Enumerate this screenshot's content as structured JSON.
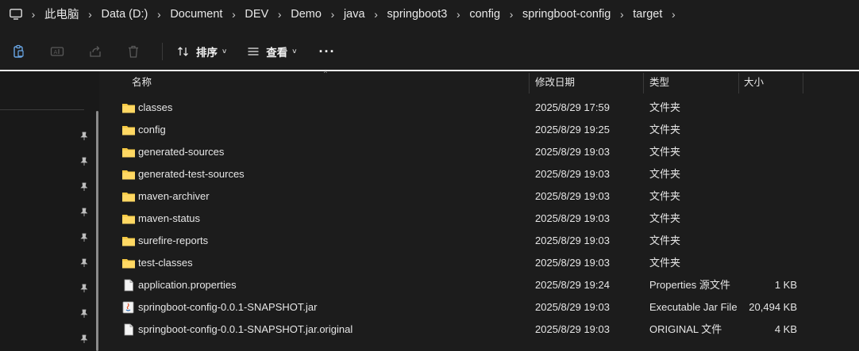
{
  "breadcrumb": {
    "items": [
      "此电脑",
      "Data (D:)",
      "Document",
      "DEV",
      "Demo",
      "java",
      "springboot3",
      "config",
      "springboot-config",
      "target"
    ]
  },
  "toolbar": {
    "sort_label": "排序",
    "view_label": "查看",
    "more_label": "···"
  },
  "columns": {
    "name": "名称",
    "date": "修改日期",
    "type": "类型",
    "size": "大小"
  },
  "files": [
    {
      "name": "classes",
      "date": "2025/8/29 17:59",
      "type": "文件夹",
      "size": "",
      "icon": "folder-icon"
    },
    {
      "name": "config",
      "date": "2025/8/29 19:25",
      "type": "文件夹",
      "size": "",
      "icon": "folder-icon"
    },
    {
      "name": "generated-sources",
      "date": "2025/8/29 19:03",
      "type": "文件夹",
      "size": "",
      "icon": "folder-icon"
    },
    {
      "name": "generated-test-sources",
      "date": "2025/8/29 19:03",
      "type": "文件夹",
      "size": "",
      "icon": "folder-icon"
    },
    {
      "name": "maven-archiver",
      "date": "2025/8/29 19:03",
      "type": "文件夹",
      "size": "",
      "icon": "folder-icon"
    },
    {
      "name": "maven-status",
      "date": "2025/8/29 19:03",
      "type": "文件夹",
      "size": "",
      "icon": "folder-icon"
    },
    {
      "name": "surefire-reports",
      "date": "2025/8/29 19:03",
      "type": "文件夹",
      "size": "",
      "icon": "folder-icon"
    },
    {
      "name": "test-classes",
      "date": "2025/8/29 19:03",
      "type": "文件夹",
      "size": "",
      "icon": "folder-icon"
    },
    {
      "name": "application.properties",
      "date": "2025/8/29 19:24",
      "type": "Properties 源文件",
      "size": "1 KB",
      "icon": "document-icon"
    },
    {
      "name": "springboot-config-0.0.1-SNAPSHOT.jar",
      "date": "2025/8/29 19:03",
      "type": "Executable Jar File",
      "size": "20,494 KB",
      "icon": "java-jar-icon"
    },
    {
      "name": "springboot-config-0.0.1-SNAPSHOT.jar.original",
      "date": "2025/8/29 19:03",
      "type": "ORIGINAL 文件",
      "size": "4 KB",
      "icon": "document-icon"
    }
  ],
  "colors": {
    "background": "#1c1c1c",
    "folder": "#f5c842",
    "text": "#e6e6e6"
  }
}
